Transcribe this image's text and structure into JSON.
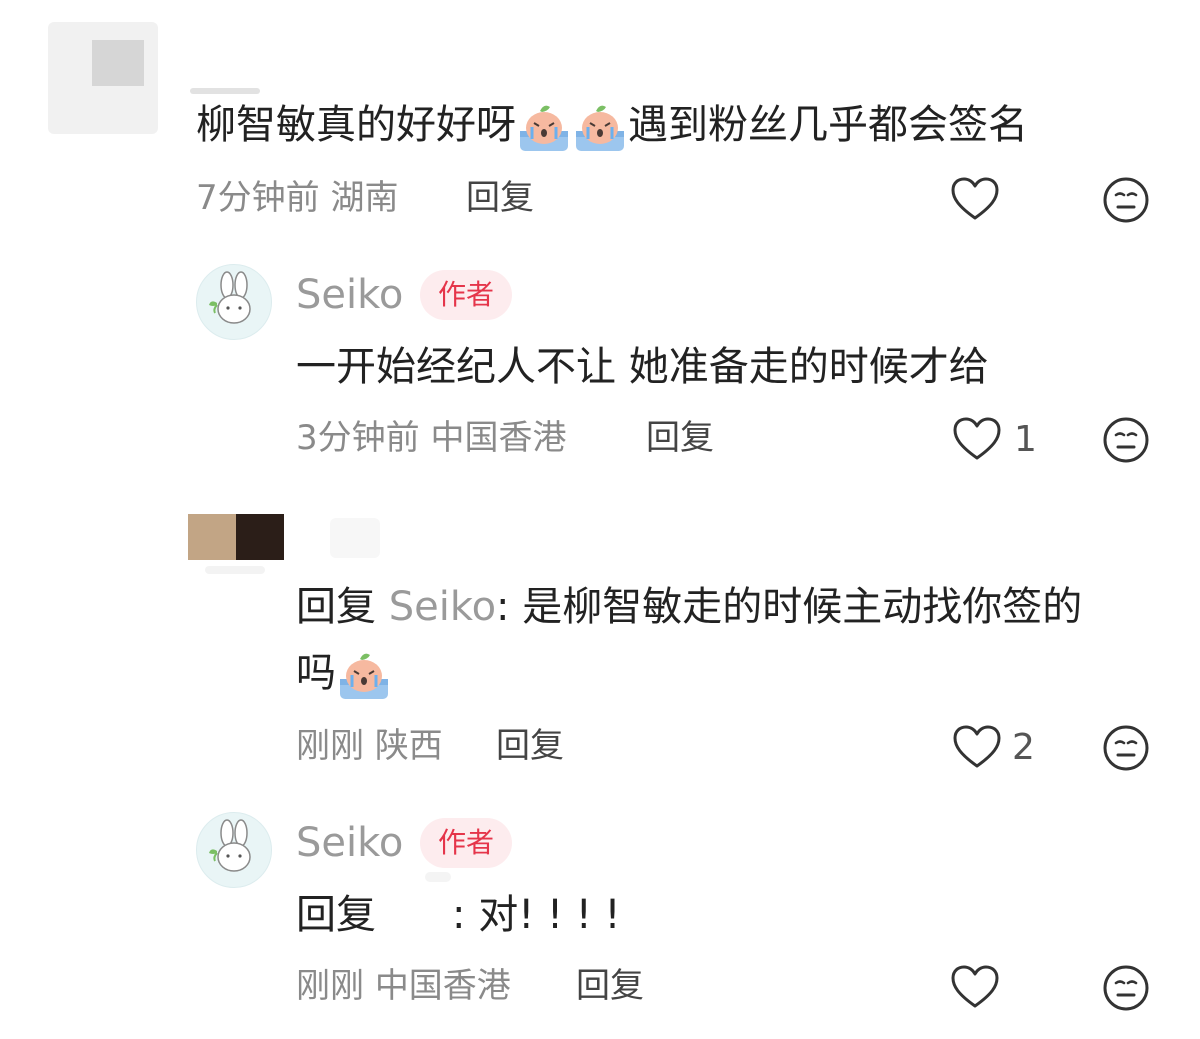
{
  "comments": [
    {
      "text_before_emoji": "柳智敏真的好好呀",
      "emoji_count": 2,
      "emoji_name": "crying-face-emoji",
      "text_after_emoji": "遇到粉丝几乎都会签名",
      "time": "7分钟前",
      "location": "湖南",
      "reply_label": "回复"
    },
    {
      "author": "Seiko",
      "badge": "作者",
      "text": "一开始经纪人不让 她准备走的时候才给",
      "time": "3分钟前",
      "location": "中国香港",
      "reply_label": "回复",
      "likes": "1"
    },
    {
      "reply_prefix": "回复",
      "reply_target": "Seiko",
      "text_line1": ": 是柳智敏走的时候主动找你签的",
      "text_line2": "吗",
      "emoji_name": "crying-face-emoji",
      "time": "刚刚",
      "location": "陕西",
      "reply_label": "回复",
      "likes": "2"
    },
    {
      "author": "Seiko",
      "badge": "作者",
      "reply_prefix": "回复",
      "text": ": 对! ! ! !",
      "time": "刚刚",
      "location": "中国香港",
      "reply_label": "回复"
    }
  ],
  "icons": {
    "like": "heart-icon",
    "dislike": "neutral-face-icon"
  },
  "colors": {
    "badge_bg": "#fdecee",
    "badge_text": "#e5354a",
    "meta_text": "#8a8a8a",
    "username": "#9a9a9a"
  }
}
